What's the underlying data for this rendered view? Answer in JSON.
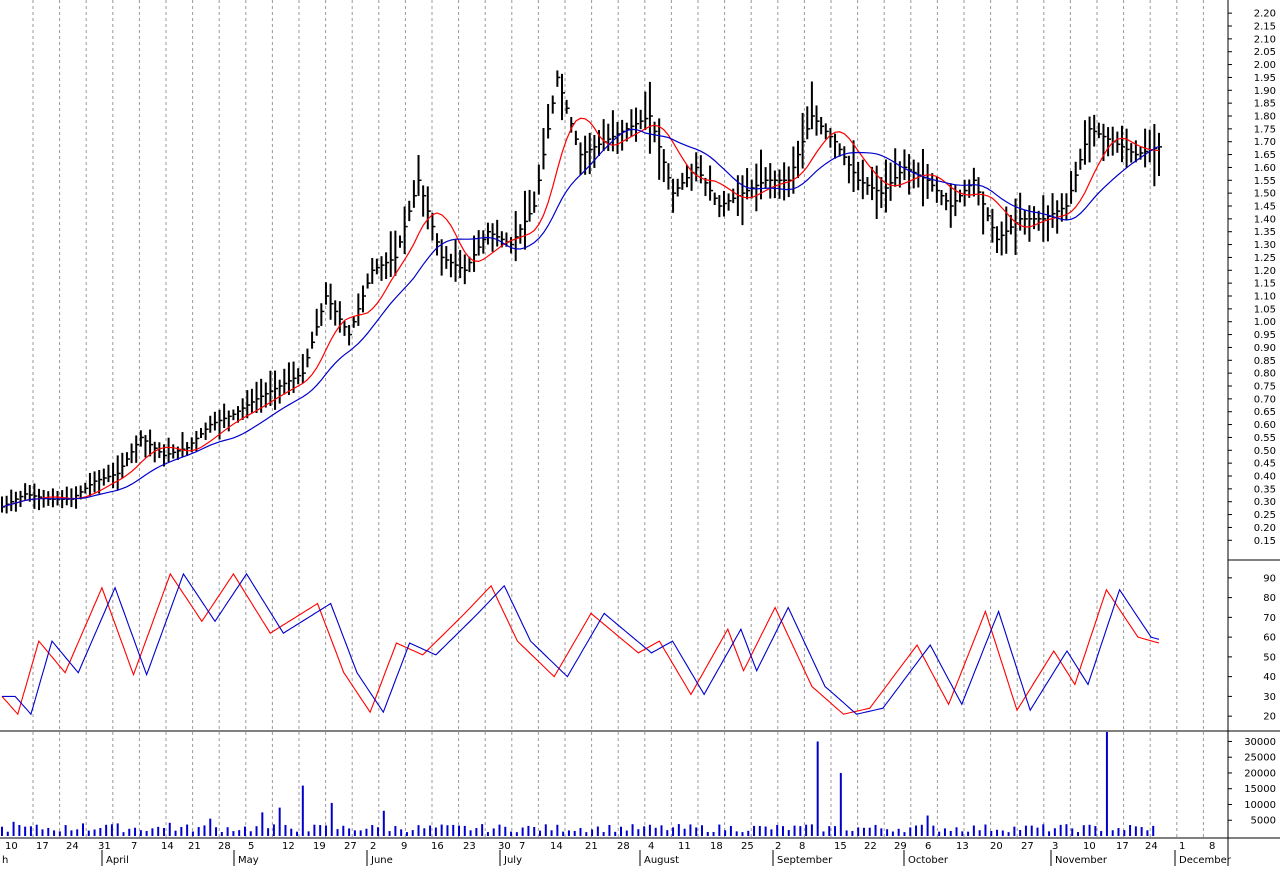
{
  "chart_data": [
    {
      "type": "ohlc",
      "panel": "price",
      "y_ticks": [
        0.15,
        0.2,
        0.25,
        0.3,
        0.35,
        0.4,
        0.45,
        0.5,
        0.55,
        0.6,
        0.65,
        0.7,
        0.75,
        0.8,
        0.85,
        0.9,
        0.95,
        1.0,
        1.05,
        1.1,
        1.15,
        1.2,
        1.25,
        1.3,
        1.35,
        1.4,
        1.45,
        1.5,
        1.55,
        1.6,
        1.65,
        1.7,
        1.75,
        1.8,
        1.85,
        1.9,
        1.95,
        2.0,
        2.05,
        2.1,
        2.15,
        2.2
      ],
      "ylim": [
        0.12,
        2.22
      ],
      "close_anchors": [
        [
          0,
          0.28
        ],
        [
          10,
          0.33
        ],
        [
          20,
          0.31
        ],
        [
          30,
          0.31
        ],
        [
          40,
          0.38
        ],
        [
          50,
          0.41
        ],
        [
          60,
          0.55
        ],
        [
          70,
          0.48
        ],
        [
          80,
          0.51
        ],
        [
          90,
          0.6
        ],
        [
          100,
          0.64
        ],
        [
          110,
          0.7
        ],
        [
          120,
          0.75
        ],
        [
          130,
          0.8
        ],
        [
          140,
          1.1
        ],
        [
          150,
          0.95
        ],
        [
          160,
          1.2
        ],
        [
          170,
          1.25
        ],
        [
          180,
          1.55
        ],
        [
          190,
          1.25
        ],
        [
          200,
          1.2
        ],
        [
          210,
          1.35
        ],
        [
          220,
          1.3
        ],
        [
          230,
          1.45
        ],
        [
          240,
          1.95
        ],
        [
          250,
          1.65
        ],
        [
          260,
          1.7
        ],
        [
          270,
          1.75
        ],
        [
          280,
          1.8
        ],
        [
          290,
          1.5
        ],
        [
          300,
          1.6
        ],
        [
          310,
          1.45
        ],
        [
          320,
          1.5
        ],
        [
          330,
          1.55
        ],
        [
          340,
          1.55
        ],
        [
          350,
          1.8
        ],
        [
          360,
          1.7
        ],
        [
          370,
          1.55
        ],
        [
          380,
          1.5
        ],
        [
          390,
          1.6
        ],
        [
          400,
          1.55
        ],
        [
          410,
          1.45
        ],
        [
          420,
          1.55
        ],
        [
          430,
          1.32
        ],
        [
          440,
          1.4
        ],
        [
          450,
          1.4
        ],
        [
          460,
          1.45
        ],
        [
          470,
          1.75
        ],
        [
          480,
          1.7
        ],
        [
          490,
          1.65
        ],
        [
          500,
          1.68
        ]
      ],
      "series": [
        {
          "name": "",
          "color": "#ff0000"
        },
        {
          "name": "",
          "color": "#0000cc"
        }
      ],
      "grid": "vertical-dashed"
    },
    {
      "type": "line",
      "panel": "stochastic",
      "y_ticks": [
        20,
        30,
        40,
        50,
        60,
        70,
        80,
        90
      ],
      "ylim": [
        14,
        96
      ],
      "k_anchors": [
        [
          0,
          30
        ],
        [
          6,
          21
        ],
        [
          14,
          58
        ],
        [
          24,
          42
        ],
        [
          38,
          85
        ],
        [
          50,
          41
        ],
        [
          64,
          92
        ],
        [
          76,
          68
        ],
        [
          88,
          92
        ],
        [
          102,
          62
        ],
        [
          120,
          77
        ],
        [
          130,
          42
        ],
        [
          140,
          22
        ],
        [
          150,
          57
        ],
        [
          160,
          51
        ],
        [
          176,
          72
        ],
        [
          186,
          86
        ],
        [
          196,
          58
        ],
        [
          210,
          40
        ],
        [
          224,
          72
        ],
        [
          242,
          52
        ],
        [
          250,
          58
        ],
        [
          262,
          31
        ],
        [
          276,
          64
        ],
        [
          282,
          43
        ],
        [
          294,
          75
        ],
        [
          308,
          35
        ],
        [
          320,
          21
        ],
        [
          330,
          24
        ],
        [
          348,
          56
        ],
        [
          360,
          26
        ],
        [
          374,
          73
        ],
        [
          386,
          23
        ],
        [
          400,
          53
        ],
        [
          408,
          36
        ],
        [
          420,
          84
        ],
        [
          432,
          60
        ],
        [
          440,
          57
        ]
      ],
      "series": [
        {
          "name": "",
          "color": "#ff0000"
        },
        {
          "name": "",
          "color": "#0000cc"
        }
      ]
    },
    {
      "type": "bar",
      "panel": "volume",
      "y_ticks": [
        5000,
        10000,
        15000,
        20000,
        25000,
        30000
      ],
      "ylim": [
        0,
        33000
      ],
      "spikes": [
        [
          4,
          4500
        ],
        [
          28,
          4000
        ],
        [
          40,
          4000
        ],
        [
          58,
          4200
        ],
        [
          72,
          5500
        ],
        [
          90,
          7500
        ],
        [
          96,
          9000
        ],
        [
          104,
          16000
        ],
        [
          114,
          10500
        ],
        [
          132,
          8000
        ],
        [
          157,
          13500
        ],
        [
          171,
          18500
        ],
        [
          229,
          14000
        ],
        [
          279,
          12000
        ],
        [
          282,
          30000
        ],
        [
          290,
          20000
        ],
        [
          320,
          6500
        ],
        [
          382,
          33000
        ],
        [
          385,
          14000
        ]
      ],
      "color": "#0000cc"
    }
  ],
  "x_axis": {
    "day_ticks": [
      "10",
      "17",
      "24",
      "31",
      "7",
      "14",
      "21",
      "28",
      "5",
      "12",
      "19",
      "27",
      "2",
      "9",
      "16",
      "23",
      "30",
      "7",
      "14",
      "21",
      "28",
      "4",
      "11",
      "18",
      "25",
      "2",
      "8",
      "15",
      "22",
      "29",
      "6",
      "13",
      "20",
      "27",
      "3",
      "10",
      "17",
      "24",
      "1",
      "8"
    ],
    "month_ticks": [
      "h",
      "April",
      "May",
      "June",
      "July",
      "August",
      "September",
      "October",
      "November",
      "December"
    ]
  }
}
